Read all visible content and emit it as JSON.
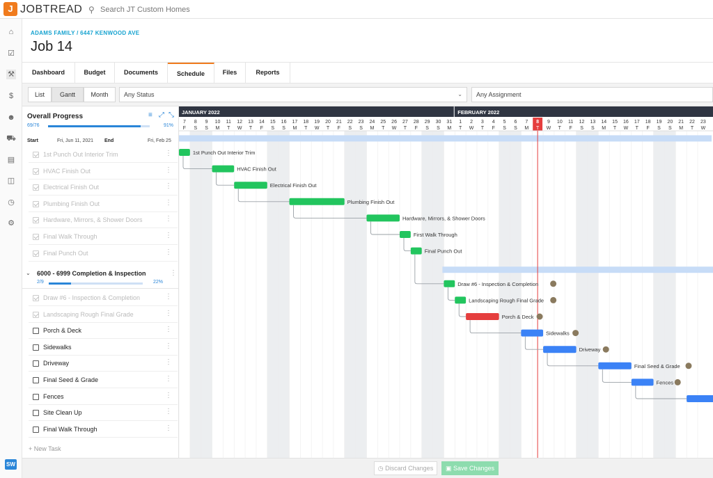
{
  "app": {
    "logo_letter": "J",
    "logo_text": "JOBTREAD",
    "search_placeholder": "Search JT Custom Homes",
    "user_initials": "SW"
  },
  "rail_icons": [
    "home-icon",
    "checkbox-icon",
    "wrench-icon",
    "dollar-icon",
    "users-icon",
    "truck-icon",
    "book-icon",
    "document-icon",
    "clock-icon",
    "gear-icon"
  ],
  "job": {
    "breadcrumb": "ADAMS FAMILY / 6447 KENWOOD AVE",
    "title": "Job 14"
  },
  "tabs": [
    {
      "label": "Dashboard",
      "active": false
    },
    {
      "label": "Budget",
      "active": false
    },
    {
      "label": "Documents",
      "active": false
    },
    {
      "label": "Schedule",
      "active": true
    },
    {
      "label": "Files",
      "active": false
    },
    {
      "label": "Reports",
      "active": false
    }
  ],
  "views": [
    {
      "label": "List",
      "selected": false
    },
    {
      "label": "Gantt",
      "selected": true
    },
    {
      "label": "Month",
      "selected": false
    }
  ],
  "filters": {
    "status": "Any Status",
    "assignment": "Any Assignment"
  },
  "overall": {
    "title": "Overall Progress",
    "count": "69/76",
    "pct_text": "91%",
    "pct": 0.91,
    "start_label": "Start",
    "start": "Fri, Jun 11, 2021",
    "end_label": "End",
    "end": "Fri, Feb 25"
  },
  "tasks_top": [
    {
      "label": "1st Punch Out Interior Trim",
      "done": true
    },
    {
      "label": "HVAC Finish Out",
      "done": true
    },
    {
      "label": "Electrical Finish Out",
      "done": true
    },
    {
      "label": "Plumbing Finish Out",
      "done": true
    },
    {
      "label": "Hardware, Mirrors, & Shower Doors",
      "done": true
    },
    {
      "label": "Final Walk Through",
      "done": true
    },
    {
      "label": "Final Punch Out",
      "done": true
    }
  ],
  "group": {
    "title": "6000 - 6999 Completion & Inspection",
    "count": "2/9",
    "pct_text": "22%",
    "pct": 0.22
  },
  "tasks_group": [
    {
      "label": "Draw #6 - Inspection & Completion",
      "done": true
    },
    {
      "label": "Landscaping Rough Final Grade",
      "done": true
    },
    {
      "label": "Porch & Deck",
      "done": false
    },
    {
      "label": "Sidewalks",
      "done": false
    },
    {
      "label": "Driveway",
      "done": false
    },
    {
      "label": "Final Seed & Grade",
      "done": false
    },
    {
      "label": "Fences",
      "done": false
    },
    {
      "label": "Site Clean Up",
      "done": false
    },
    {
      "label": "Final Walk Through",
      "done": false
    }
  ],
  "new_task": "+ New Task",
  "footer": {
    "discard": "Discard Changes",
    "save": "Save Changes"
  },
  "gantt": {
    "months": [
      {
        "label": "JANUARY 2022",
        "start_index": 0
      },
      {
        "label": "FEBRUARY 2022",
        "start_index": 25
      }
    ],
    "days": [
      "7",
      "8",
      "9",
      "10",
      "11",
      "12",
      "13",
      "14",
      "15",
      "16",
      "17",
      "18",
      "19",
      "20",
      "21",
      "22",
      "23",
      "24",
      "25",
      "26",
      "27",
      "28",
      "29",
      "30",
      "31",
      "1",
      "2",
      "3",
      "4",
      "5",
      "6",
      "7",
      "8",
      "9",
      "10",
      "11",
      "12",
      "13",
      "14",
      "15",
      "16",
      "17",
      "18",
      "19",
      "20",
      "21",
      "22",
      "23"
    ],
    "weekdays": [
      "F",
      "S",
      "S",
      "M",
      "T",
      "W",
      "T",
      "F",
      "S",
      "S",
      "M",
      "T",
      "W",
      "T",
      "F",
      "S",
      "S",
      "M",
      "T",
      "W",
      "T",
      "F",
      "S",
      "S",
      "M",
      "T",
      "W",
      "T",
      "F",
      "S",
      "S",
      "M",
      "T",
      "W",
      "T",
      "F",
      "S",
      "S",
      "M",
      "T",
      "W",
      "T",
      "F",
      "S",
      "S",
      "M",
      "T",
      "W"
    ],
    "today_index": 32,
    "colors": {
      "done": "#22c55e",
      "late": "#e53e3e",
      "upcoming": "#3b82f6",
      "group": "#c7dcf7",
      "today": "#e53e3e",
      "header": "#2f3542"
    },
    "bars": [
      {
        "label": "1st Punch Out Interior Trim",
        "start": 0,
        "span": 1,
        "status": "done",
        "row": 0,
        "avatar": false
      },
      {
        "label": "HVAC Finish Out",
        "start": 3,
        "span": 2,
        "status": "done",
        "row": 1,
        "avatar": false
      },
      {
        "label": "Electrical Finish Out",
        "start": 5,
        "span": 3,
        "status": "done",
        "row": 2,
        "avatar": false
      },
      {
        "label": "Plumbing Finish Out",
        "start": 10,
        "span": 5,
        "status": "done",
        "row": 3,
        "avatar": false
      },
      {
        "label": "Hardware, Mirrors, & Shower Doors",
        "start": 17,
        "span": 3,
        "status": "done",
        "row": 4,
        "avatar": false
      },
      {
        "label": "First Walk Through",
        "start": 20,
        "span": 1,
        "status": "done",
        "row": 5,
        "avatar": false
      },
      {
        "label": "Final Punch Out",
        "start": 21,
        "span": 1,
        "status": "done",
        "row": 6,
        "avatar": false
      },
      {
        "label": "Draw #6 - Inspection & Completion",
        "start": 24,
        "span": 1,
        "status": "done",
        "row": 8,
        "avatar": true
      },
      {
        "label": "Landscaping Rough Final Grade",
        "start": 25,
        "span": 1,
        "status": "done",
        "row": 9,
        "avatar": true
      },
      {
        "label": "Porch & Deck",
        "start": 26,
        "span": 3,
        "status": "late",
        "row": 10,
        "avatar": true
      },
      {
        "label": "Sidewalks",
        "start": 31,
        "span": 2,
        "status": "upcoming",
        "row": 11,
        "avatar": true
      },
      {
        "label": "Driveway",
        "start": 33,
        "span": 3,
        "status": "upcoming",
        "row": 12,
        "avatar": true
      },
      {
        "label": "Final Seed & Grade",
        "start": 38,
        "span": 3,
        "status": "upcoming",
        "row": 13,
        "avatar": true
      },
      {
        "label": "Fences",
        "start": 41,
        "span": 2,
        "status": "upcoming",
        "row": 14,
        "avatar": true
      },
      {
        "label": "",
        "start": 46,
        "span": 3,
        "status": "upcoming",
        "row": 15,
        "avatar": false
      }
    ],
    "group_bars": [
      {
        "start": 0,
        "row": -1
      },
      {
        "start": 24,
        "row": 7
      }
    ]
  }
}
